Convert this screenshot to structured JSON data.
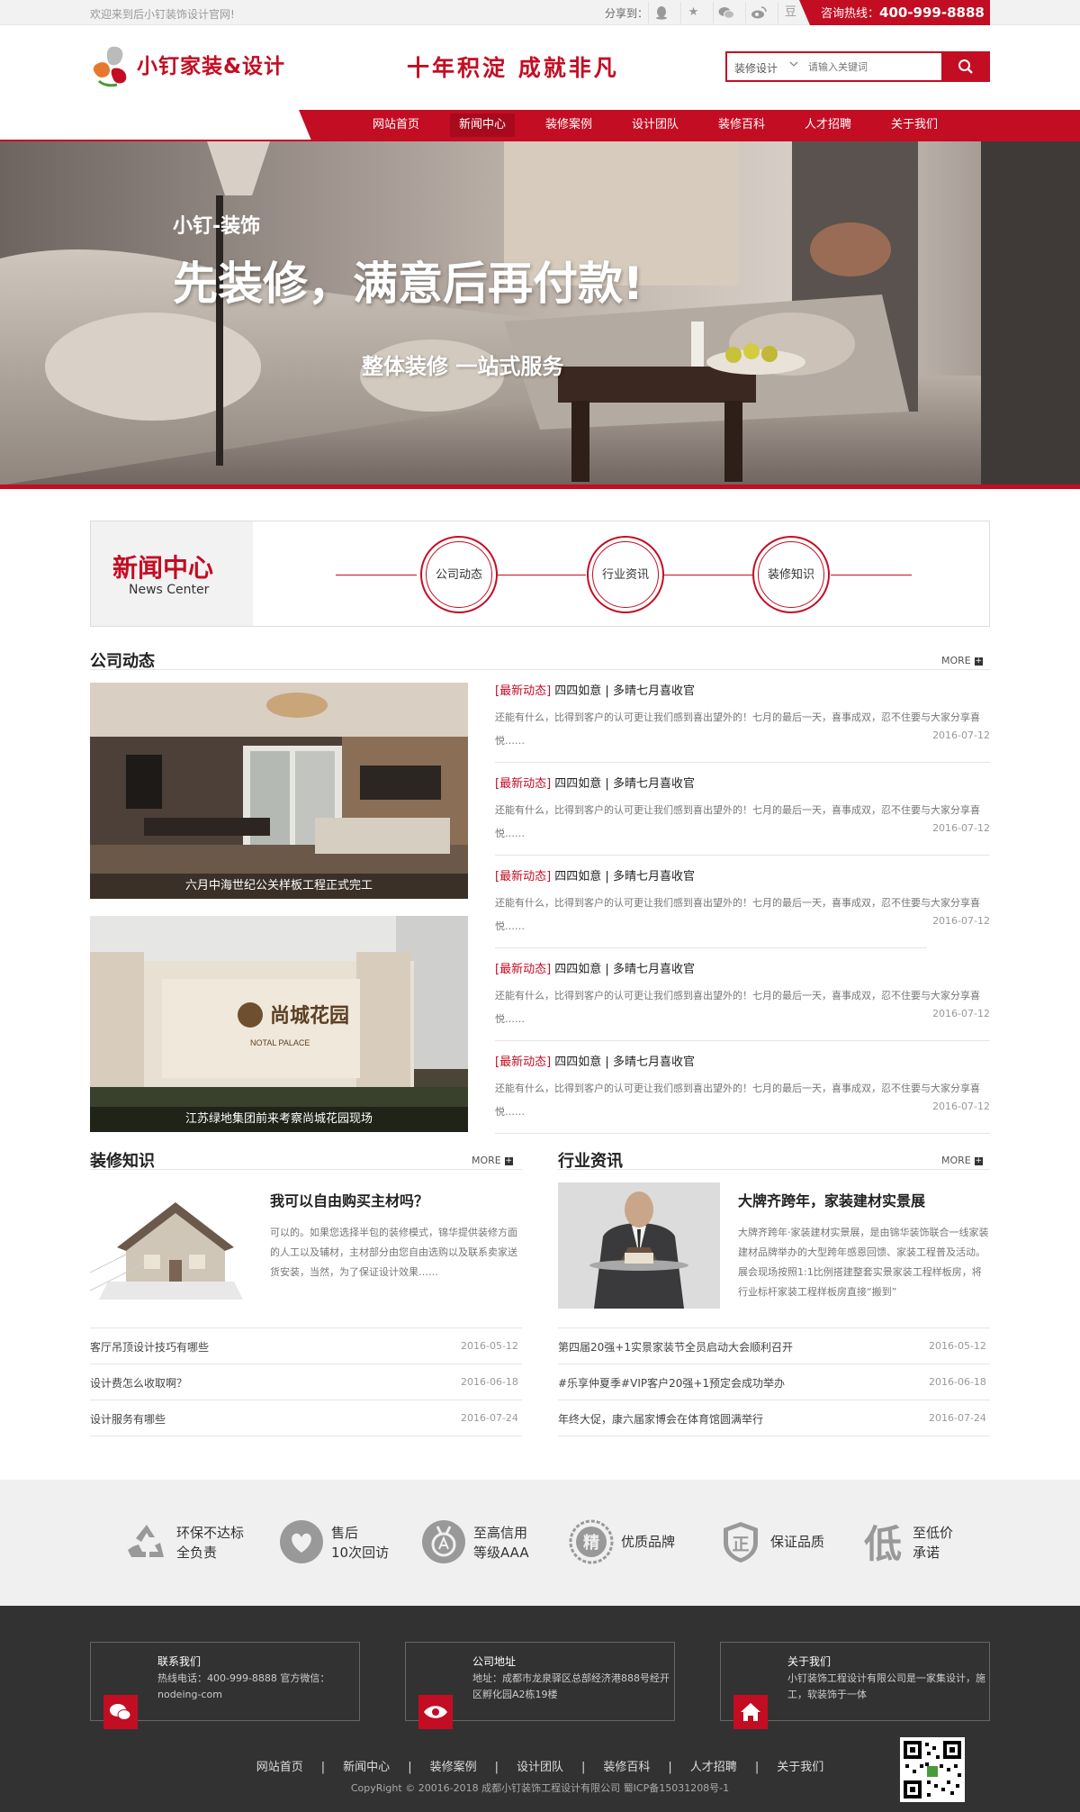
{
  "topbar": {
    "welcome": "欢迎来到后小钉装饰设计官网!",
    "share_label": "分享到：",
    "share_icons": [
      "qq-icon",
      "star-icon",
      "wechat-icon",
      "weibo-icon",
      "douban-icon"
    ],
    "douban_glyph": "豆",
    "hotline_label": "咨询热线：",
    "hotline_number": "400-999-8888"
  },
  "header": {
    "logo_text": "小钉家装&设计",
    "slogan": "十年积淀 成就非凡",
    "search": {
      "category": "装修设计",
      "placeholder": "请输入关键词"
    }
  },
  "nav": {
    "items": [
      "网站首页",
      "新闻中心",
      "装修案例",
      "设计团队",
      "装修百科",
      "人才招聘",
      "关于我们"
    ],
    "active": "新闻中心"
  },
  "banner": {
    "small": "小钉-装饰",
    "big": "先装修，满意后再付款!",
    "sub": "整体装修 一站式服务"
  },
  "news_center": {
    "title_zh": "新闻中心",
    "title_en": "News Center",
    "tabs": [
      "公司动态",
      "行业资讯",
      "装修知识"
    ]
  },
  "company": {
    "title": "公司动态",
    "more": "MORE",
    "photos": [
      {
        "caption": "六月中海世纪公关样板工程正式完工"
      },
      {
        "caption": "江苏绿地集团前来考察尚城花园现场",
        "sign_text": "尚城花园",
        "sign_en": "NOTAL PALACE"
      }
    ],
    "news": [
      {
        "tag": "[最新动态]",
        "title": "四四如意 | 多晴七月喜收官",
        "desc": "还能有什么，比得到客户的认可更让我们感到喜出望外的！七月的最后一天，喜事成双，忍不住要与大家分享喜悦……",
        "date": "2016-07-12"
      },
      {
        "tag": "[最新动态]",
        "title": "四四如意 | 多晴七月喜收官",
        "desc": "还能有什么，比得到客户的认可更让我们感到喜出望外的！七月的最后一天，喜事成双，忍不住要与大家分享喜悦……",
        "date": "2016-07-12"
      },
      {
        "tag": "[最新动态]",
        "title": "四四如意 | 多晴七月喜收官",
        "desc": "还能有什么，比得到客户的认可更让我们感到喜出望外的！七月的最后一天，喜事成双，忍不住要与大家分享喜悦……",
        "date": "2016-07-12"
      },
      {
        "tag": "[最新动态]",
        "title": "四四如意 | 多晴七月喜收官",
        "desc": "还能有什么，比得到客户的认可更让我们感到喜出望外的！七月的最后一天，喜事成双，忍不住要与大家分享喜悦……",
        "date": "2016-07-12"
      },
      {
        "tag": "[最新动态]",
        "title": "四四如意 | 多晴七月喜收官",
        "desc": "还能有什么，比得到客户的认可更让我们感到喜出望外的！七月的最后一天，喜事成双，忍不住要与大家分享喜悦……",
        "date": "2016-07-12"
      }
    ]
  },
  "knowledge": {
    "title": "装修知识",
    "more": "MORE",
    "feature_title": "我可以自由购买主材吗？",
    "feature_desc": "可以的。如果您选择半包的装修模式，锦华提供装修方面的人工以及辅材，主材部分由您自由选购以及联系卖家送货安装，当然，为了保证设计效果……",
    "list": [
      {
        "title": "客厅吊顶设计技巧有哪些",
        "date": "2016-05-12"
      },
      {
        "title": "设计费怎么收取啊？",
        "date": "2016-06-18"
      },
      {
        "title": "设计服务有哪些",
        "date": "2016-07-24"
      }
    ]
  },
  "industry": {
    "title": "行业资讯",
    "more": "MORE",
    "feature_title": "大牌齐跨年，家装建材实景展",
    "feature_desc": "大牌齐跨年·家装建材实景展，是由锦华装饰联合一线家装建材品牌举办的大型跨年感恩回馈、家装工程普及活动。展会现场按照1:1比例搭建整套实景家装工程样板房，将行业标杆家装工程样板房直接“搬到”",
    "list": [
      {
        "title": "第四届20强+1实景家装节全员启动大会顺利召开",
        "date": "2016-05-12"
      },
      {
        "title": "#乐享仲夏季#VIP客户20强+1预定会成功举办",
        "date": "2016-06-18"
      },
      {
        "title": "年终大促，康六届家博会在体育馆圆满举行",
        "date": "2016-07-24"
      }
    ]
  },
  "features": [
    {
      "line1": "环保不达标",
      "line2": "全负责",
      "icon": "recycle-icon"
    },
    {
      "line1": "售后",
      "line2": "10次回访",
      "icon": "heart-icon"
    },
    {
      "line1": "至高信用",
      "line2": "等级AAA",
      "icon": "medal-icon"
    },
    {
      "line1": "优质品牌",
      "line2": "",
      "icon": "quality-seal-icon",
      "glyph": "精"
    },
    {
      "line1": "保证品质",
      "line2": "",
      "icon": "guarantee-shield-icon",
      "glyph": "正"
    },
    {
      "line1": "至低价",
      "line2": "承诺",
      "icon": "low-price-icon",
      "glyph": "低"
    }
  ],
  "footer": {
    "boxes": [
      {
        "title": "联系我们",
        "text": "热线电话：400-999-8888 官方微信：nodeing-com",
        "icon": "wechat-icon"
      },
      {
        "title": "公司地址",
        "text": "地址：成都市龙泉驿区总部经济港888号经开区孵化园A2栋19楼",
        "icon": "eye-icon"
      },
      {
        "title": "关于我们",
        "text": "小钉装饰工程设计有限公司是一家集设计，施工，软装饰于一体",
        "icon": "home-icon"
      }
    ],
    "nav": [
      "网站首页",
      "新闻中心",
      "装修案例",
      "设计团队",
      "装修百科",
      "人才招聘",
      "关于我们"
    ],
    "separator": "|",
    "copyright": "CopyRight © 20016-2018 成都小钉装饰工程设计有限公司 蜀ICP备15031208号-1"
  },
  "colors": {
    "brand_red": "#c30d23",
    "footer_bg": "#323232",
    "feature_bg": "#f0f0f0"
  }
}
